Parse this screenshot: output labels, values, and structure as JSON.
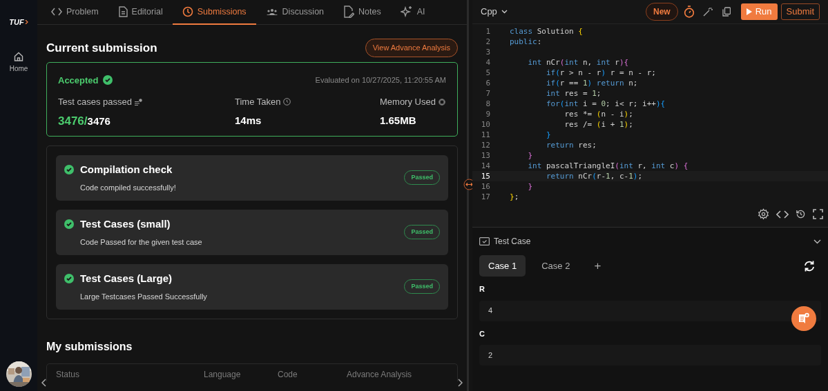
{
  "sidebar": {
    "logo": "TUF",
    "items": [
      {
        "label": "Home",
        "selected": false
      }
    ]
  },
  "tabs": [
    {
      "label": "Problem",
      "selected": false
    },
    {
      "label": "Editorial",
      "selected": false
    },
    {
      "label": "Submissions",
      "selected": true
    },
    {
      "label": "Discussion",
      "selected": false
    },
    {
      "label": "Notes",
      "selected": false
    },
    {
      "label": "AI",
      "selected": false
    }
  ],
  "current_submission": {
    "heading": "Current submission",
    "action": "View Advance Analysis",
    "status": "Accepted",
    "evaluated": "Evaluated on 10/27/2025, 11:20:55 AM",
    "stats": [
      {
        "label": "Test cases passed",
        "passed": "3476/",
        "total": "3476"
      },
      {
        "label": "Time Taken",
        "value": "14ms"
      },
      {
        "label": "Memory Used",
        "value": "1.65MB"
      }
    ]
  },
  "checks": [
    {
      "title": "Compilation check",
      "detail": "Code compiled successfully!",
      "badge": "Passed"
    },
    {
      "title": "Test Cases (small)",
      "detail": "Code Passed for the given test case",
      "badge": "Passed"
    },
    {
      "title": "Test Cases (Large)",
      "detail": "Large Testcases Passed Successfully",
      "badge": "Passed"
    }
  ],
  "my_submissions": {
    "heading": "My submissions",
    "columns": [
      "Status",
      "Language",
      "Code",
      "Advance Analysis"
    ]
  },
  "editor": {
    "language": "Cpp",
    "new_button": "New",
    "run_button": "Run",
    "submit_button": "Submit",
    "lines": [
      {
        "number": "1",
        "current": false,
        "tokens": [
          {
            "kind": "keyword",
            "text": "class"
          },
          {
            "kind": "plain",
            "text": " Solution "
          },
          {
            "kind": "gold",
            "text": "{"
          }
        ]
      },
      {
        "number": "2",
        "current": false,
        "tokens": [
          {
            "kind": "keyword",
            "text": "public"
          },
          {
            "kind": "plain",
            "text": ":"
          }
        ]
      },
      {
        "number": "3",
        "current": false
      },
      {
        "number": "4",
        "current": false,
        "tokens": [
          {
            "kind": "keyword",
            "text": "    int"
          },
          {
            "kind": "plain",
            "text": " nCr"
          },
          {
            "kind": "pink",
            "text": "("
          },
          {
            "kind": "keyword",
            "text": "int"
          },
          {
            "kind": "plain",
            "text": " n, "
          },
          {
            "kind": "keyword",
            "text": "int"
          },
          {
            "kind": "plain",
            "text": " r"
          },
          {
            "kind": "pink",
            "text": "){"
          }
        ]
      },
      {
        "number": "5",
        "current": false,
        "tokens": [
          {
            "kind": "keyword",
            "text": "        if"
          },
          {
            "kind": "blue",
            "text": "("
          },
          {
            "kind": "plain",
            "text": "r > n - r"
          },
          {
            "kind": "blue",
            "text": ")"
          },
          {
            "kind": "plain",
            "text": " r = n - r;"
          }
        ]
      },
      {
        "number": "6",
        "current": false,
        "tokens": [
          {
            "kind": "keyword",
            "text": "        if"
          },
          {
            "kind": "blue",
            "text": "("
          },
          {
            "kind": "plain",
            "text": "r == "
          },
          {
            "kind": "number",
            "text": "1"
          },
          {
            "kind": "blue",
            "text": ")"
          },
          {
            "kind": "keyword",
            "text": " return"
          },
          {
            "kind": "plain",
            "text": " n;"
          }
        ]
      },
      {
        "number": "7",
        "current": false,
        "tokens": [
          {
            "kind": "keyword",
            "text": "        int"
          },
          {
            "kind": "plain",
            "text": " res = "
          },
          {
            "kind": "number",
            "text": "1"
          },
          {
            "kind": "plain",
            "text": ";"
          }
        ]
      },
      {
        "number": "8",
        "current": false,
        "tokens": [
          {
            "kind": "keyword",
            "text": "        for"
          },
          {
            "kind": "blue",
            "text": "("
          },
          {
            "kind": "keyword",
            "text": "int"
          },
          {
            "kind": "plain",
            "text": " i = "
          },
          {
            "kind": "number",
            "text": "0"
          },
          {
            "kind": "plain",
            "text": "; i< r; i++"
          },
          {
            "kind": "blue",
            "text": "){"
          }
        ]
      },
      {
        "number": "9",
        "current": false,
        "tokens": [
          {
            "kind": "plain",
            "text": "            res *= "
          },
          {
            "kind": "gold",
            "text": "("
          },
          {
            "kind": "plain",
            "text": "n - i"
          },
          {
            "kind": "gold",
            "text": ")"
          },
          {
            "kind": "plain",
            "text": ";"
          }
        ]
      },
      {
        "number": "10",
        "current": false,
        "tokens": [
          {
            "kind": "plain",
            "text": "            res /= "
          },
          {
            "kind": "gold",
            "text": "("
          },
          {
            "kind": "plain",
            "text": "i + "
          },
          {
            "kind": "number",
            "text": "1"
          },
          {
            "kind": "gold",
            "text": ")"
          },
          {
            "kind": "plain",
            "text": ";"
          }
        ]
      },
      {
        "number": "11",
        "current": false,
        "tokens": [
          {
            "kind": "blue",
            "text": "        }"
          }
        ]
      },
      {
        "number": "12",
        "current": false,
        "tokens": [
          {
            "kind": "keyword",
            "text": "        return"
          },
          {
            "kind": "plain",
            "text": " res;"
          }
        ]
      },
      {
        "number": "13",
        "current": false,
        "tokens": [
          {
            "kind": "pink",
            "text": "    }"
          }
        ]
      },
      {
        "number": "14",
        "current": false,
        "tokens": [
          {
            "kind": "keyword",
            "text": "    int"
          },
          {
            "kind": "plain",
            "text": " pascalTriangleI"
          },
          {
            "kind": "pink",
            "text": "("
          },
          {
            "kind": "keyword",
            "text": "int"
          },
          {
            "kind": "plain",
            "text": " r, "
          },
          {
            "kind": "keyword",
            "text": "int"
          },
          {
            "kind": "plain",
            "text": " c"
          },
          {
            "kind": "pink",
            "text": ") {"
          }
        ]
      },
      {
        "number": "15",
        "current": true,
        "tokens": [
          {
            "kind": "keyword",
            "text": "        return"
          },
          {
            "kind": "plain",
            "text": " nCr"
          },
          {
            "kind": "blue",
            "text": "("
          },
          {
            "kind": "plain",
            "text": "r-"
          },
          {
            "kind": "number",
            "text": "1"
          },
          {
            "kind": "plain",
            "text": ", c-"
          },
          {
            "kind": "number",
            "text": "1"
          },
          {
            "kind": "blue",
            "text": ")"
          },
          {
            "kind": "plain",
            "text": ";"
          }
        ]
      },
      {
        "number": "16",
        "current": false,
        "tokens": [
          {
            "kind": "pink",
            "text": "    }"
          }
        ]
      },
      {
        "number": "17",
        "current": false,
        "tokens": [
          {
            "kind": "gold",
            "text": "}"
          },
          {
            "kind": "plain",
            "text": ";"
          }
        ]
      }
    ]
  },
  "test_case": {
    "title": "Test Case",
    "cases": [
      {
        "label": "Case 1",
        "selected": true
      },
      {
        "label": "Case 2",
        "selected": false
      }
    ],
    "add": "+",
    "inputs": [
      {
        "label": "R",
        "value": "4"
      },
      {
        "label": "C",
        "value": "2"
      }
    ]
  }
}
